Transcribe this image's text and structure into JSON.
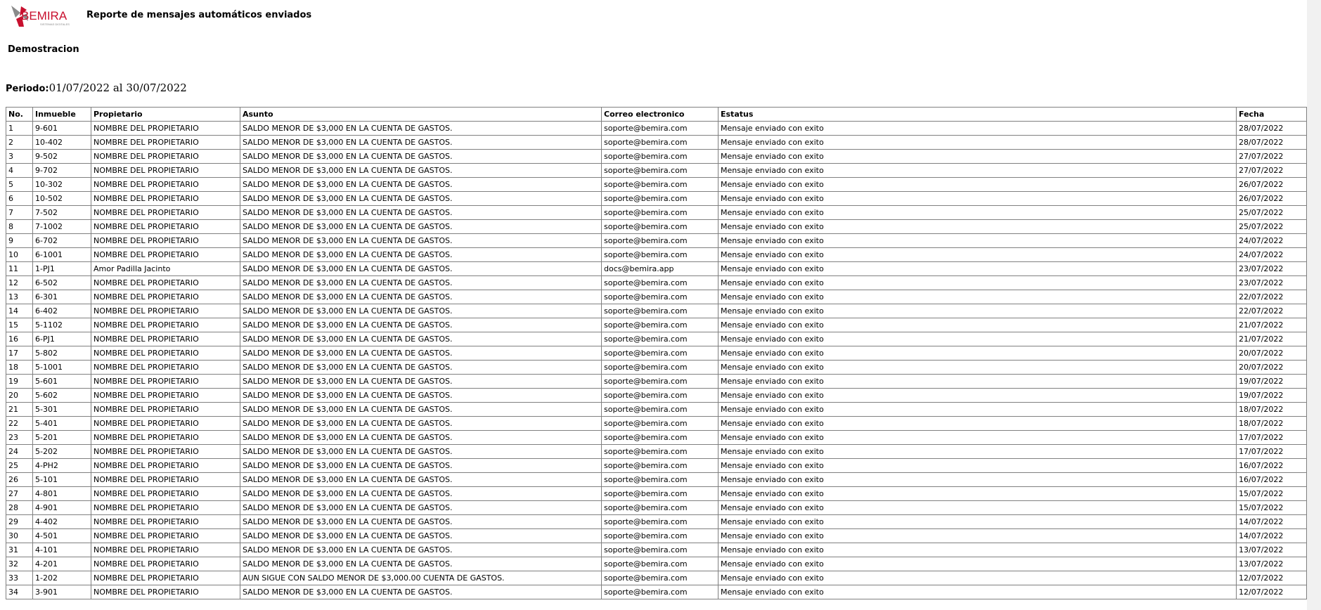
{
  "header": {
    "logo_text": "BEMIRA",
    "logo_tagline": "SISTEMAS DIGITALES",
    "title": "Reporte de mensajes automáticos enviados"
  },
  "company": "Demostracion",
  "period": {
    "label": "Periodo:",
    "value": "01/07/2022 al 30/07/2022"
  },
  "colors": {
    "logo_red": "#c8102e",
    "logo_gray": "#8a8a8a",
    "border": "#808080"
  },
  "table": {
    "columns": [
      "No.",
      "Inmueble",
      "Propietario",
      "Asunto",
      "Correo electronico",
      "Estatus",
      "Fecha"
    ],
    "rows": [
      [
        "1",
        "9-601",
        "NOMBRE DEL PROPIETARIO",
        "SALDO MENOR DE $3,000 EN LA CUENTA DE GASTOS.",
        "soporte@bemira.com",
        "Mensaje enviado con exito",
        "28/07/2022"
      ],
      [
        "2",
        "10-402",
        "NOMBRE DEL PROPIETARIO",
        "SALDO MENOR DE $3,000 EN LA CUENTA DE GASTOS.",
        "soporte@bemira.com",
        "Mensaje enviado con exito",
        "28/07/2022"
      ],
      [
        "3",
        "9-502",
        "NOMBRE DEL PROPIETARIO",
        "SALDO MENOR DE $3,000 EN LA CUENTA DE GASTOS.",
        "soporte@bemira.com",
        "Mensaje enviado con exito",
        "27/07/2022"
      ],
      [
        "4",
        "9-702",
        "NOMBRE DEL PROPIETARIO",
        "SALDO MENOR DE $3,000 EN LA CUENTA DE GASTOS.",
        "soporte@bemira.com",
        "Mensaje enviado con exito",
        "27/07/2022"
      ],
      [
        "5",
        "10-302",
        "NOMBRE DEL PROPIETARIO",
        "SALDO MENOR DE $3,000 EN LA CUENTA DE GASTOS.",
        "soporte@bemira.com",
        "Mensaje enviado con exito",
        "26/07/2022"
      ],
      [
        "6",
        "10-502",
        "NOMBRE DEL PROPIETARIO",
        "SALDO MENOR DE $3,000 EN LA CUENTA DE GASTOS.",
        "soporte@bemira.com",
        "Mensaje enviado con exito",
        "26/07/2022"
      ],
      [
        "7",
        "7-502",
        "NOMBRE DEL PROPIETARIO",
        "SALDO MENOR DE $3,000 EN LA CUENTA DE GASTOS.",
        "soporte@bemira.com",
        "Mensaje enviado con exito",
        "25/07/2022"
      ],
      [
        "8",
        "7-1002",
        "NOMBRE DEL PROPIETARIO",
        "SALDO MENOR DE $3,000 EN LA CUENTA DE GASTOS.",
        "soporte@bemira.com",
        "Mensaje enviado con exito",
        "25/07/2022"
      ],
      [
        "9",
        "6-702",
        "NOMBRE DEL PROPIETARIO",
        "SALDO MENOR DE $3,000 EN LA CUENTA DE GASTOS.",
        "soporte@bemira.com",
        "Mensaje enviado con exito",
        "24/07/2022"
      ],
      [
        "10",
        "6-1001",
        "NOMBRE DEL PROPIETARIO",
        "SALDO MENOR DE $3,000 EN LA CUENTA DE GASTOS.",
        "soporte@bemira.com",
        "Mensaje enviado con exito",
        "24/07/2022"
      ],
      [
        "11",
        "1-PJ1",
        "Amor Padilla Jacinto",
        "SALDO MENOR DE $3,000 EN LA CUENTA DE GASTOS.",
        "docs@bemira.app",
        "Mensaje enviado con exito",
        "23/07/2022"
      ],
      [
        "12",
        "6-502",
        "NOMBRE DEL PROPIETARIO",
        "SALDO MENOR DE $3,000 EN LA CUENTA DE GASTOS.",
        "soporte@bemira.com",
        "Mensaje enviado con exito",
        "23/07/2022"
      ],
      [
        "13",
        "6-301",
        "NOMBRE DEL PROPIETARIO",
        "SALDO MENOR DE $3,000 EN LA CUENTA DE GASTOS.",
        "soporte@bemira.com",
        "Mensaje enviado con exito",
        "22/07/2022"
      ],
      [
        "14",
        "6-402",
        "NOMBRE DEL PROPIETARIO",
        "SALDO MENOR DE $3,000 EN LA CUENTA DE GASTOS.",
        "soporte@bemira.com",
        "Mensaje enviado con exito",
        "22/07/2022"
      ],
      [
        "15",
        "5-1102",
        "NOMBRE DEL PROPIETARIO",
        "SALDO MENOR DE $3,000 EN LA CUENTA DE GASTOS.",
        "soporte@bemira.com",
        "Mensaje enviado con exito",
        "21/07/2022"
      ],
      [
        "16",
        "6-PJ1",
        "NOMBRE DEL PROPIETARIO",
        "SALDO MENOR DE $3,000 EN LA CUENTA DE GASTOS.",
        "soporte@bemira.com",
        "Mensaje enviado con exito",
        "21/07/2022"
      ],
      [
        "17",
        "5-802",
        "NOMBRE DEL PROPIETARIO",
        "SALDO MENOR DE $3,000 EN LA CUENTA DE GASTOS.",
        "soporte@bemira.com",
        "Mensaje enviado con exito",
        "20/07/2022"
      ],
      [
        "18",
        "5-1001",
        "NOMBRE DEL PROPIETARIO",
        "SALDO MENOR DE $3,000 EN LA CUENTA DE GASTOS.",
        "soporte@bemira.com",
        "Mensaje enviado con exito",
        "20/07/2022"
      ],
      [
        "19",
        "5-601",
        "NOMBRE DEL PROPIETARIO",
        "SALDO MENOR DE $3,000 EN LA CUENTA DE GASTOS.",
        "soporte@bemira.com",
        "Mensaje enviado con exito",
        "19/07/2022"
      ],
      [
        "20",
        "5-602",
        "NOMBRE DEL PROPIETARIO",
        "SALDO MENOR DE $3,000 EN LA CUENTA DE GASTOS.",
        "soporte@bemira.com",
        "Mensaje enviado con exito",
        "19/07/2022"
      ],
      [
        "21",
        "5-301",
        "NOMBRE DEL PROPIETARIO",
        "SALDO MENOR DE $3,000 EN LA CUENTA DE GASTOS.",
        "soporte@bemira.com",
        "Mensaje enviado con exito",
        "18/07/2022"
      ],
      [
        "22",
        "5-401",
        "NOMBRE DEL PROPIETARIO",
        "SALDO MENOR DE $3,000 EN LA CUENTA DE GASTOS.",
        "soporte@bemira.com",
        "Mensaje enviado con exito",
        "18/07/2022"
      ],
      [
        "23",
        "5-201",
        "NOMBRE DEL PROPIETARIO",
        "SALDO MENOR DE $3,000 EN LA CUENTA DE GASTOS.",
        "soporte@bemira.com",
        "Mensaje enviado con exito",
        "17/07/2022"
      ],
      [
        "24",
        "5-202",
        "NOMBRE DEL PROPIETARIO",
        "SALDO MENOR DE $3,000 EN LA CUENTA DE GASTOS.",
        "soporte@bemira.com",
        "Mensaje enviado con exito",
        "17/07/2022"
      ],
      [
        "25",
        "4-PH2",
        "NOMBRE DEL PROPIETARIO",
        "SALDO MENOR DE $3,000 EN LA CUENTA DE GASTOS.",
        "soporte@bemira.com",
        "Mensaje enviado con exito",
        "16/07/2022"
      ],
      [
        "26",
        "5-101",
        "NOMBRE DEL PROPIETARIO",
        "SALDO MENOR DE $3,000 EN LA CUENTA DE GASTOS.",
        "soporte@bemira.com",
        "Mensaje enviado con exito",
        "16/07/2022"
      ],
      [
        "27",
        "4-801",
        "NOMBRE DEL PROPIETARIO",
        "SALDO MENOR DE $3,000 EN LA CUENTA DE GASTOS.",
        "soporte@bemira.com",
        "Mensaje enviado con exito",
        "15/07/2022"
      ],
      [
        "28",
        "4-901",
        "NOMBRE DEL PROPIETARIO",
        "SALDO MENOR DE $3,000 EN LA CUENTA DE GASTOS.",
        "soporte@bemira.com",
        "Mensaje enviado con exito",
        "15/07/2022"
      ],
      [
        "29",
        "4-402",
        "NOMBRE DEL PROPIETARIO",
        "SALDO MENOR DE $3,000 EN LA CUENTA DE GASTOS.",
        "soporte@bemira.com",
        "Mensaje enviado con exito",
        "14/07/2022"
      ],
      [
        "30",
        "4-501",
        "NOMBRE DEL PROPIETARIO",
        "SALDO MENOR DE $3,000 EN LA CUENTA DE GASTOS.",
        "soporte@bemira.com",
        "Mensaje enviado con exito",
        "14/07/2022"
      ],
      [
        "31",
        "4-101",
        "NOMBRE DEL PROPIETARIO",
        "SALDO MENOR DE $3,000 EN LA CUENTA DE GASTOS.",
        "soporte@bemira.com",
        "Mensaje enviado con exito",
        "13/07/2022"
      ],
      [
        "32",
        "4-201",
        "NOMBRE DEL PROPIETARIO",
        "SALDO MENOR DE $3,000 EN LA CUENTA DE GASTOS.",
        "soporte@bemira.com",
        "Mensaje enviado con exito",
        "13/07/2022"
      ],
      [
        "33",
        "1-202",
        "NOMBRE DEL PROPIETARIO",
        "AUN SIGUE CON SALDO MENOR DE $3,000.00 CUENTA DE GASTOS.",
        "soporte@bemira.com",
        "Mensaje enviado con exito",
        "12/07/2022"
      ],
      [
        "34",
        "3-901",
        "NOMBRE DEL PROPIETARIO",
        "SALDO MENOR DE $3,000 EN LA CUENTA DE GASTOS.",
        "soporte@bemira.com",
        "Mensaje enviado con exito",
        "12/07/2022"
      ]
    ]
  }
}
